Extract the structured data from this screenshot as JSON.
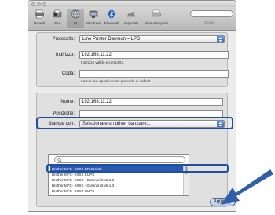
{
  "toolbar": {
    "items": [
      {
        "label": "Default",
        "icon": "default-printer-icon"
      },
      {
        "label": "Fax",
        "icon": "fax-icon"
      },
      {
        "label": "IP",
        "icon": "ip-globe-icon"
      },
      {
        "label": "Windows",
        "icon": "windows-icon"
      },
      {
        "label": "Bluetooth",
        "icon": "bluetooth-icon"
      },
      {
        "label": "AppleTalk",
        "icon": "appletalk-icon"
      },
      {
        "label": "Altre stampanti",
        "icon": "more-printers-icon"
      }
    ],
    "search_label": "Cerca"
  },
  "protocol": {
    "label": "Protocollo:",
    "value": "Line Printer Daemon – LPD"
  },
  "address": {
    "label": "Indirizzo:",
    "value": "192.168.11.22",
    "hint": "Indirizzo valido e completo."
  },
  "queue": {
    "label": "Coda:",
    "value": "",
    "hint": "Lascia uno spazio vuoto per coda di default."
  },
  "name": {
    "label": "Nome:",
    "value": "192.168.11.22"
  },
  "location": {
    "label": "Posizione:",
    "value": ""
  },
  "print_using": {
    "label": "Stampa con:",
    "value": "Selezionare un driver da usare..."
  },
  "driver_list": {
    "items": [
      "Brother MFC- XXXX BR-Script3",
      "Brother MFC- XXXX CUPS",
      "Brother MFC- XXXX - Gutenprint v5.1.3",
      "Brother MFC- XXXX - Gutenprint v5.1.3",
      "Brother MFC- XXXX CUPS"
    ],
    "selected_index": 0
  },
  "add_button": {
    "label": "Aggiungi"
  },
  "colors": {
    "highlight": "#1f4fa0",
    "selection": "#2a59b3",
    "arrow": "#2f5fa8"
  }
}
